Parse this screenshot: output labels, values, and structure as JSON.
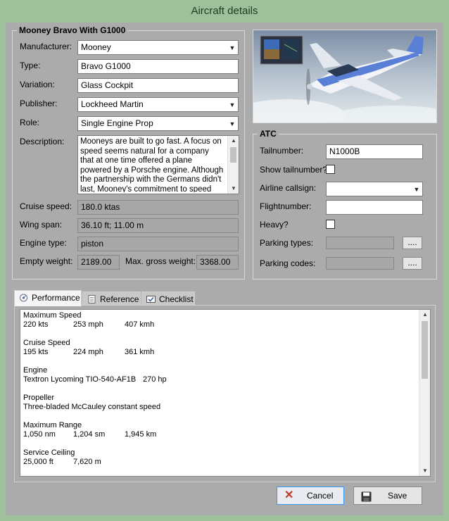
{
  "window": {
    "title": "Aircraft details"
  },
  "aircraft": {
    "group_title": "Mooney Bravo With G1000",
    "manufacturer_label": "Manufacturer:",
    "manufacturer": "Mooney",
    "type_label": "Type:",
    "type": "Bravo G1000",
    "variation_label": "Variation:",
    "variation": "Glass Cockpit",
    "publisher_label": "Publisher:",
    "publisher": "Lockheed Martin",
    "role_label": "Role:",
    "role": "Single Engine Prop",
    "description_label": "Description:",
    "description": "Mooneys are built to go fast. A focus on speed seems natural for a company that at one time offered a plane powered by a Porsche engine. Although the partnership with the Germans didn't last, Mooney's commitment to speed certainly has. In",
    "cruise_label": "Cruise speed:",
    "cruise": "180.0 ktas",
    "wing_label": "Wing span:",
    "wing": "36.10 ft; 11.00 m",
    "engine_label": "Engine type:",
    "engine": "piston",
    "empty_weight_label": "Empty weight:",
    "empty_weight": "2189.00",
    "max_gross_label": "Max. gross weight:",
    "max_gross": "3368.00"
  },
  "atc": {
    "group_title": "ATC",
    "tailnumber_label": "Tailnumber:",
    "tailnumber": "N1000B",
    "show_tailnumber_label": "Show tailnumber?",
    "airline_label": "Airline callsign:",
    "airline": "",
    "flightnumber_label": "Flightnumber:",
    "flightnumber": "",
    "heavy_label": "Heavy?",
    "parking_types_label": "Parking types:",
    "parking_types": "",
    "parking_codes_label": "Parking codes:",
    "parking_codes": "",
    "browse_label": "...."
  },
  "tabs": [
    {
      "label": "Performance",
      "icon": "performance-icon"
    },
    {
      "label": "Reference",
      "icon": "document-icon"
    },
    {
      "label": "Checklist",
      "icon": "checklist-icon"
    }
  ],
  "performance": {
    "max_speed": {
      "title": "Maximum Speed",
      "v1": "220 kts",
      "v2": "253 mph",
      "v3": "407 kmh"
    },
    "cruise_speed": {
      "title": "Cruise Speed",
      "v1": "195 kts",
      "v2": "224 mph",
      "v3": "361 kmh"
    },
    "engine": {
      "title": "Engine",
      "v1": "Textron Lycoming TIO-540-AF1B",
      "v2": "270 hp"
    },
    "propeller": {
      "title": "Propeller",
      "v1": "Three-bladed McCauley constant speed"
    },
    "max_range": {
      "title": "Maximum Range",
      "v1": "1,050 nm",
      "v2": "1,204 sm",
      "v3": "1,945 km"
    },
    "ceiling": {
      "title": "Service Ceiling",
      "v1": "25,000 ft",
      "v2": "7,620 m"
    }
  },
  "buttons": {
    "cancel": "Cancel",
    "save": "Save"
  },
  "colors": {
    "window_frame": "#9ec19c",
    "client": "#ababab",
    "accent": "#3399ff"
  }
}
